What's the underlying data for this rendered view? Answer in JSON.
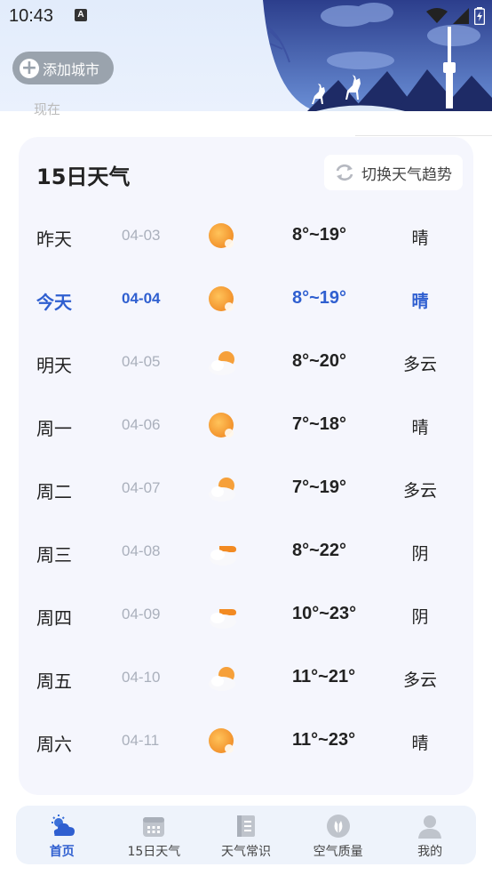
{
  "status_bar": {
    "time": "10:43",
    "notification_badge": "A"
  },
  "header": {
    "add_city_label": "添加城市",
    "location_peek": "现在"
  },
  "forecast": {
    "title": "15日天气",
    "switch_label": "切换天气趋势",
    "rows": [
      {
        "day": "昨天",
        "date": "04-03",
        "icon": "sun-icon",
        "temp": "8°~19°",
        "cond": "晴"
      },
      {
        "day": "今天",
        "date": "04-04",
        "icon": "sun-icon",
        "temp": "8°~19°",
        "cond": "晴",
        "today": true
      },
      {
        "day": "明天",
        "date": "04-05",
        "icon": "partly-cloudy-icon",
        "temp": "8°~20°",
        "cond": "多云"
      },
      {
        "day": "周一",
        "date": "04-06",
        "icon": "sun-icon",
        "temp": "7°~18°",
        "cond": "晴"
      },
      {
        "day": "周二",
        "date": "04-07",
        "icon": "partly-cloudy-icon",
        "temp": "7°~19°",
        "cond": "多云"
      },
      {
        "day": "周三",
        "date": "04-08",
        "icon": "overcast-icon",
        "temp": "8°~22°",
        "cond": "阴"
      },
      {
        "day": "周四",
        "date": "04-09",
        "icon": "overcast-icon",
        "temp": "10°~23°",
        "cond": "阴"
      },
      {
        "day": "周五",
        "date": "04-10",
        "icon": "partly-cloudy-icon",
        "temp": "11°~21°",
        "cond": "多云"
      },
      {
        "day": "周六",
        "date": "04-11",
        "icon": "sun-icon",
        "temp": "11°~23°",
        "cond": "晴"
      }
    ]
  },
  "nav": {
    "items": [
      {
        "label": "首页",
        "icon": "home-weather-icon",
        "active": true
      },
      {
        "label": "15日天气",
        "icon": "calendar-icon"
      },
      {
        "label": "天气常识",
        "icon": "book-icon"
      },
      {
        "label": "空气质量",
        "icon": "leaf-icon"
      },
      {
        "label": "我的",
        "icon": "user-icon"
      }
    ]
  },
  "colors": {
    "accent": "#2f5fd0",
    "sun": "#f6a03a",
    "card_bg": "#f5f6fd"
  }
}
